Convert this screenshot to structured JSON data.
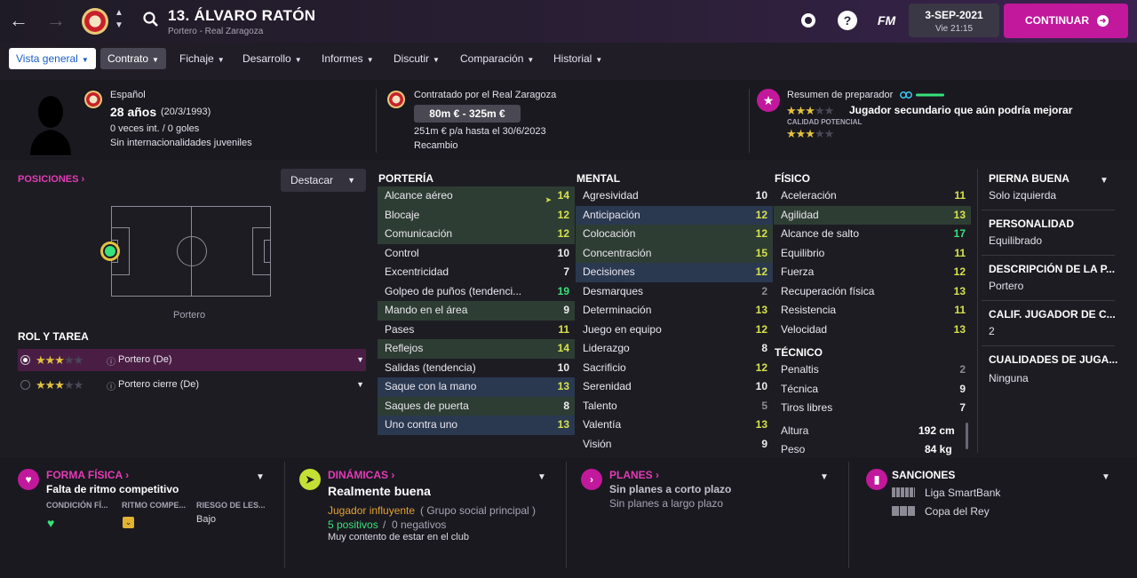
{
  "header": {
    "player_name": "13. ÁLVARO RATÓN",
    "subtitle": "Portero - Real Zaragoza",
    "fm_label": "FM",
    "help_label": "?",
    "date": "3-SEP-2021",
    "day_time": "Vie 21:15",
    "continue_label": "CONTINUAR"
  },
  "tabs": [
    {
      "label": "Vista general"
    },
    {
      "label": "Contrato"
    },
    {
      "label": "Fichaje"
    },
    {
      "label": "Desarrollo"
    },
    {
      "label": "Informes"
    },
    {
      "label": "Discutir"
    },
    {
      "label": "Comparación"
    },
    {
      "label": "Historial"
    }
  ],
  "profile": {
    "nationality": "Español",
    "age": "28 años",
    "birth": "(20/3/1993)",
    "caps": "0 veces int. / 0 goles",
    "youth": "Sin internacionalidades juveniles"
  },
  "contract": {
    "signed_by": "Contratado por el Real Zaragoza",
    "value": "80m € - 325m €",
    "wage": "251m € p/a hasta el 30/6/2023",
    "role": "Recambio"
  },
  "coach": {
    "title": "Resumen de preparador",
    "current_stars": 3,
    "summary": "Jugador secundario que aún podría mejorar",
    "potential_label": "CALIDAD POTENCIAL",
    "potential_stars": 3
  },
  "positions": {
    "title": "POSICIONES",
    "highlight_label": "Destacar",
    "position_label": "Portero"
  },
  "roles": {
    "title": "ROL Y TAREA",
    "items": [
      {
        "label": "Portero (De)",
        "stars": 3
      },
      {
        "label": "Portero cierre (De)",
        "stars": 3
      }
    ]
  },
  "attributes": {
    "porteria_title": "PORTERÍA",
    "porteria": [
      {
        "name": "Alcance aéreo",
        "value": "14",
        "hl": "g"
      },
      {
        "name": "Blocaje",
        "value": "12",
        "hl": "g"
      },
      {
        "name": "Comunicación",
        "value": "12",
        "hl": "g"
      },
      {
        "name": "Control",
        "value": "10",
        "hl": ""
      },
      {
        "name": "Excentricidad",
        "value": "7",
        "hl": ""
      },
      {
        "name": "Golpeo de puños (tendenci...",
        "value": "19",
        "hl": ""
      },
      {
        "name": "Mando en el área",
        "value": "9",
        "hl": "g"
      },
      {
        "name": "Pases",
        "value": "11",
        "hl": ""
      },
      {
        "name": "Reflejos",
        "value": "14",
        "hl": "g"
      },
      {
        "name": "Salidas (tendencia)",
        "value": "10",
        "hl": ""
      },
      {
        "name": "Saque con la mano",
        "value": "13",
        "hl": "b"
      },
      {
        "name": "Saques de puerta",
        "value": "8",
        "hl": "g"
      },
      {
        "name": "Uno contra uno",
        "value": "13",
        "hl": "b"
      }
    ],
    "mental_title": "MENTAL",
    "mental": [
      {
        "name": "Agresividad",
        "value": "10",
        "hl": ""
      },
      {
        "name": "Anticipación",
        "value": "12",
        "hl": "b"
      },
      {
        "name": "Colocación",
        "value": "12",
        "hl": "g"
      },
      {
        "name": "Concentración",
        "value": "15",
        "hl": "g"
      },
      {
        "name": "Decisiones",
        "value": "12",
        "hl": "b"
      },
      {
        "name": "Desmarques",
        "value": "2",
        "hl": ""
      },
      {
        "name": "Determinación",
        "value": "13",
        "hl": ""
      },
      {
        "name": "Juego en equipo",
        "value": "12",
        "hl": ""
      },
      {
        "name": "Liderazgo",
        "value": "8",
        "hl": ""
      },
      {
        "name": "Sacrificio",
        "value": "12",
        "hl": ""
      },
      {
        "name": "Serenidad",
        "value": "10",
        "hl": ""
      },
      {
        "name": "Talento",
        "value": "5",
        "hl": ""
      },
      {
        "name": "Valentía",
        "value": "13",
        "hl": ""
      },
      {
        "name": "Visión",
        "value": "9",
        "hl": ""
      }
    ],
    "fisico_title": "FÍSICO",
    "fisico": [
      {
        "name": "Aceleración",
        "value": "11",
        "hl": ""
      },
      {
        "name": "Agilidad",
        "value": "13",
        "hl": "g"
      },
      {
        "name": "Alcance de salto",
        "value": "17",
        "hl": ""
      },
      {
        "name": "Equilibrio",
        "value": "11",
        "hl": ""
      },
      {
        "name": "Fuerza",
        "value": "12",
        "hl": ""
      },
      {
        "name": "Recuperación física",
        "value": "13",
        "hl": ""
      },
      {
        "name": "Resistencia",
        "value": "11",
        "hl": ""
      },
      {
        "name": "Velocidad",
        "value": "13",
        "hl": ""
      }
    ],
    "tecnico_title": "TÉCNICO",
    "tecnico": [
      {
        "name": "Penaltis",
        "value": "2",
        "hl": ""
      },
      {
        "name": "Técnica",
        "value": "9",
        "hl": ""
      },
      {
        "name": "Tiros libres",
        "value": "7",
        "hl": ""
      }
    ],
    "height_label": "Altura",
    "height": "192 cm",
    "weight_label": "Peso",
    "weight": "84 kg"
  },
  "details": [
    {
      "title": "PIERNA BUENA",
      "value": "Solo izquierda"
    },
    {
      "title": "PERSONALIDAD",
      "value": "Equilibrado"
    },
    {
      "title": "DESCRIPCIÓN DE LA P...",
      "value": "Portero"
    },
    {
      "title": "CALIF. JUGADOR DE C...",
      "value": "2"
    },
    {
      "title": "CUALIDADES DE JUGA...",
      "value": "Ninguna"
    }
  ],
  "bottom": {
    "forma_title": "FORMA FÍSICA",
    "forma_status": "Falta de ritmo competitivo",
    "forma_cols": [
      "CONDICIÓN FÍ...",
      "RITMO COMPE...",
      "RIESGO DE LES..."
    ],
    "forma_risk": "Bajo",
    "dinamicas_title": "DINÁMICAS",
    "dinamicas_status": "Realmente buena",
    "influence": "Jugador influyente",
    "group": "( Grupo social principal )",
    "positives": "5 positivos",
    "slash": "/",
    "negatives": "0 negativos",
    "happiness": "Muy contento de estar en el club",
    "planes_title": "PLANES",
    "planes_short": "Sin planes a corto plazo",
    "planes_long": "Sin planes a largo plazo",
    "sanciones_title": "SANCIONES",
    "sanciones": [
      "Liga SmartBank",
      "Copa del Rey"
    ]
  },
  "colors": {
    "accent": "#c2189b",
    "pink": "#e43bb6",
    "good": "#37e27a",
    "yellow": "#d7e24b"
  }
}
